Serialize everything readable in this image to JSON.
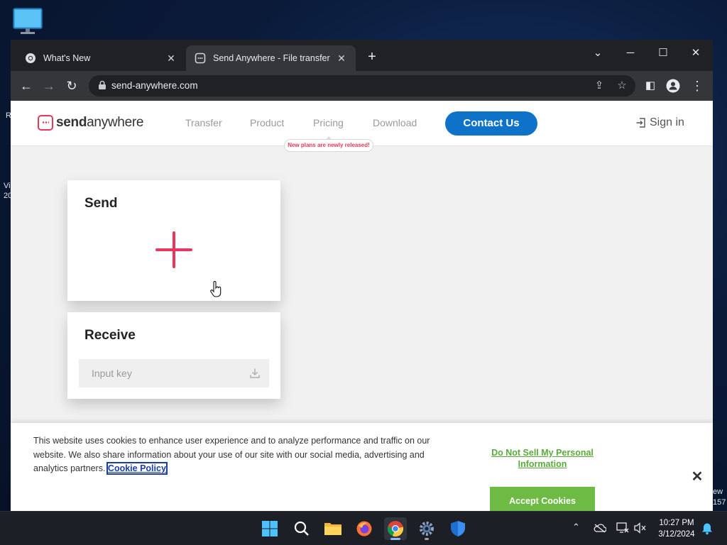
{
  "desktop": {
    "side_fragments": [
      "R",
      "Vi",
      "20",
      "ew",
      "157"
    ]
  },
  "browser": {
    "tabs": [
      {
        "title": "What's New",
        "icon": "chrome-icon",
        "active": false
      },
      {
        "title": "Send Anywhere - File transfer",
        "icon": "sendanywhere-favicon",
        "active": true
      }
    ],
    "new_tab_symbol": "+",
    "url": "send-anywhere.com"
  },
  "site": {
    "logo_bold": "send",
    "logo_light": "anywhere",
    "nav": {
      "transfer": "Transfer",
      "product": "Product",
      "pricing": "Pricing",
      "download": "Download"
    },
    "contact_label": "Contact Us",
    "pricing_badge": "New plans are newly released!",
    "signin_label": "Sign in",
    "accent_color": "#e8375b",
    "brand_blue": "#0e72c9"
  },
  "send_card": {
    "title": "Send"
  },
  "receive_card": {
    "title": "Receive",
    "input_placeholder": "Input key"
  },
  "cookie_banner": {
    "text": "This website uses cookies to enhance user experience and to analyze performance and traffic on our website. We also share information about your use of our site with our social media, advertising and analytics partners.",
    "policy_link": "Cookie Policy",
    "do_not_sell": "Do Not Sell My Personal Information",
    "accept_label": "Accept Cookies",
    "close_symbol": "✕"
  },
  "taskbar": {
    "time": "10:27 PM",
    "date": "3/12/2024"
  }
}
